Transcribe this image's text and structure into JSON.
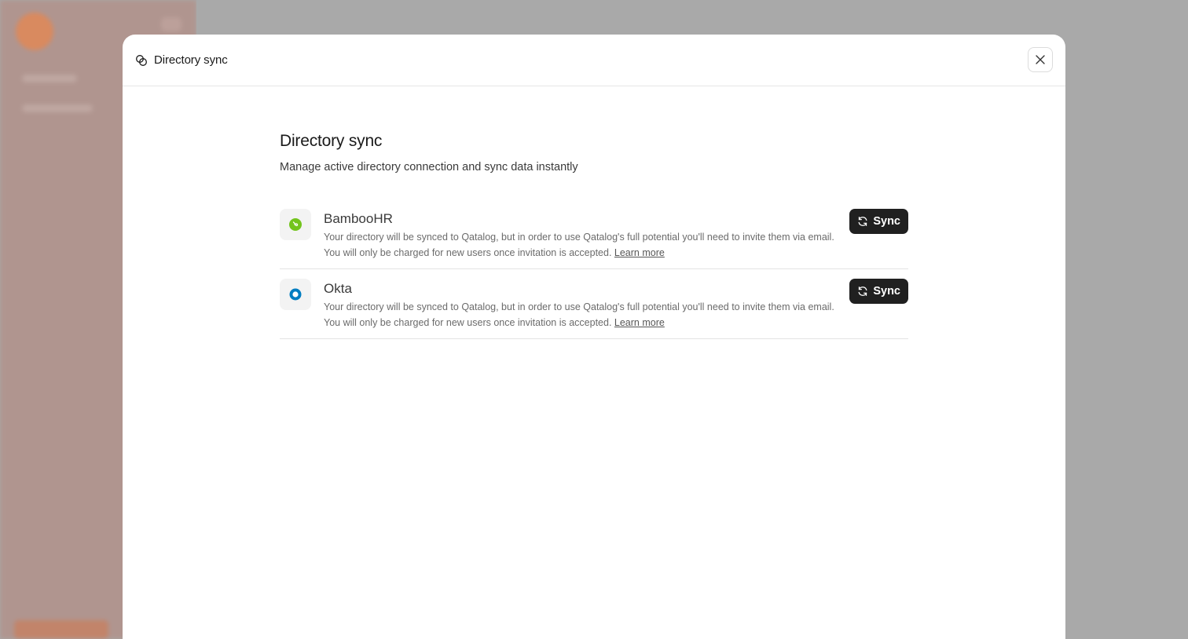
{
  "modal": {
    "header_title": "Directory sync",
    "close_icon": "close-icon"
  },
  "page": {
    "title": "Directory sync",
    "subtitle": "Manage active directory connection and sync data instantly"
  },
  "integrations": [
    {
      "name": "BambooHR",
      "icon": "bamboohr-logo",
      "color": "#73c41d",
      "desc_line1": "Your directory will be synced to Qatalog, but in order to use Qatalog's full potential you'll need to invite them via email.",
      "desc_line2": "You will only be charged for new users once invitation is accepted.",
      "link": "Learn more",
      "button": "Sync"
    },
    {
      "name": "Okta",
      "icon": "okta-logo",
      "color": "#007dc1",
      "desc_line1": "Your directory will be synced to Qatalog, but in order to use Qatalog's full potential you'll need to invite them via email.",
      "desc_line2": "You will only be charged for new users once invitation is accepted.",
      "link": "Learn more",
      "button": "Sync"
    }
  ]
}
